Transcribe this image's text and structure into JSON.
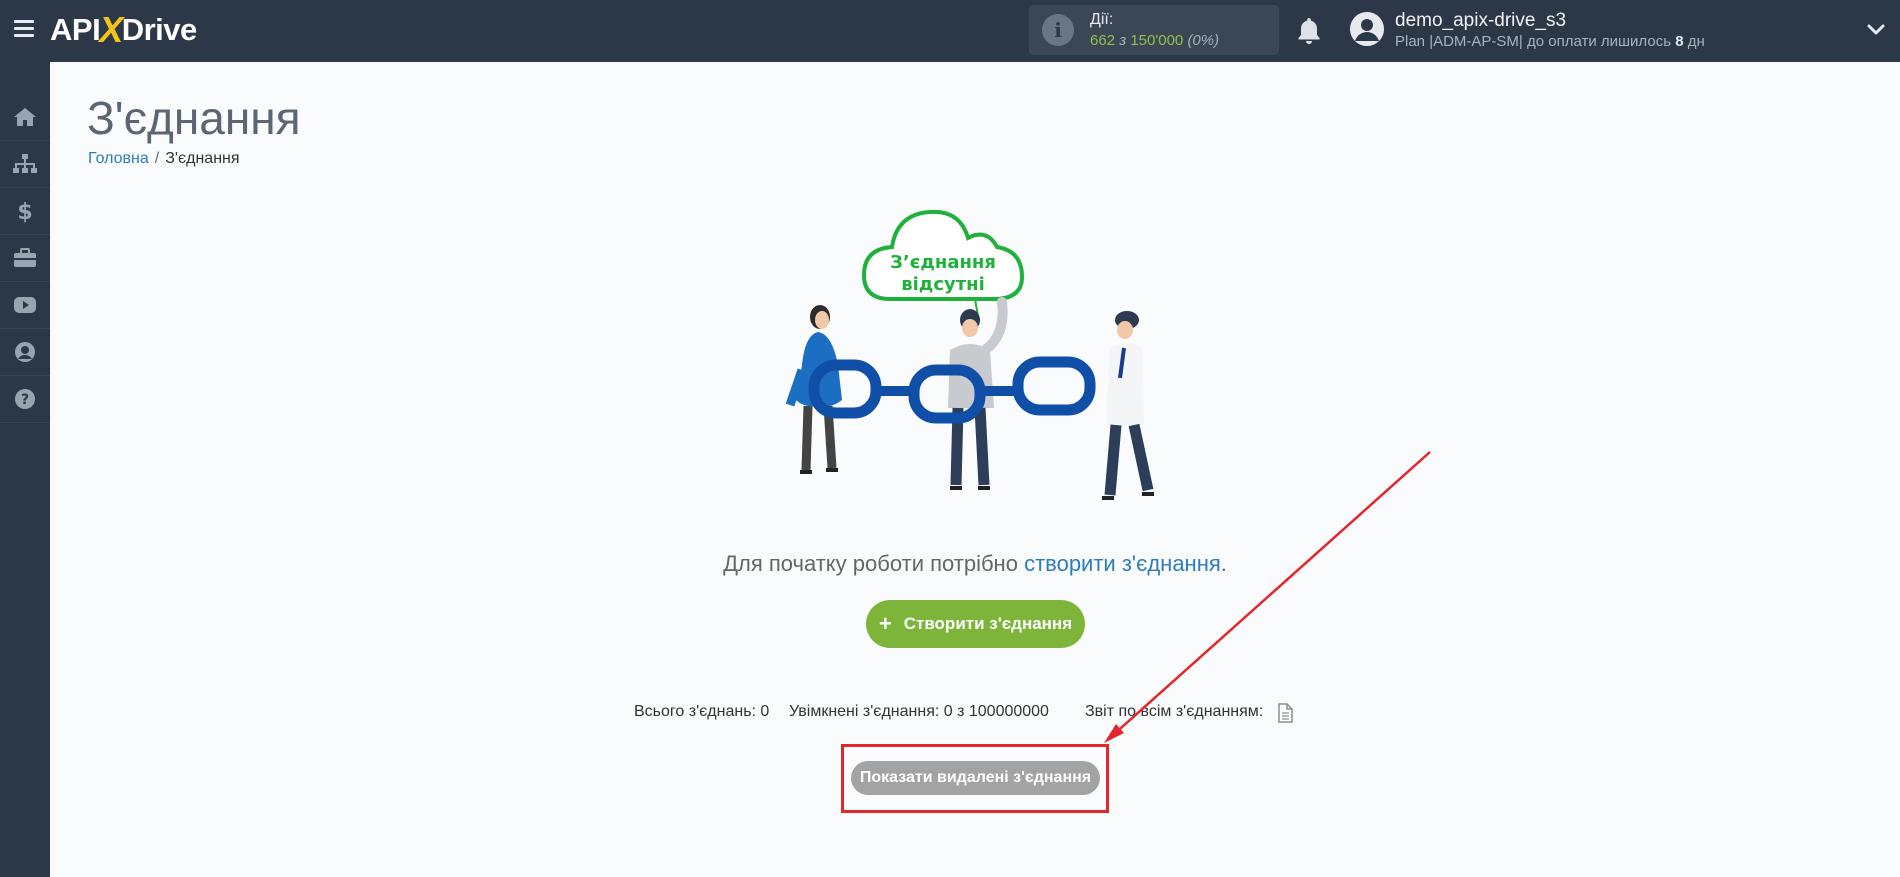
{
  "app": {
    "logo_part1": "API",
    "logo_x": "X",
    "logo_part2": "Drive"
  },
  "header": {
    "actions_label": "Дії:",
    "actions_used": "662",
    "actions_separator": " з ",
    "actions_total": "150'000",
    "actions_percent": "(0%)",
    "user_name": "demo_apix-drive_s3",
    "plan_text": "Plan |ADM-AP-SM| до оплати лишилось ",
    "days_left": "8",
    "days_unit": " дн"
  },
  "sidebar": {
    "items": [
      {
        "icon": "home-icon"
      },
      {
        "icon": "sitemap-icon"
      },
      {
        "icon": "dollar-icon"
      },
      {
        "icon": "briefcase-icon"
      },
      {
        "icon": "youtube-icon"
      },
      {
        "icon": "user-circle-icon"
      },
      {
        "icon": "question-icon"
      }
    ]
  },
  "page": {
    "title": "З'єднання",
    "breadcrumb_home": "Головна",
    "breadcrumb_sep": "/",
    "breadcrumb_current": "З'єднання"
  },
  "illustration": {
    "cloud_line1": "З’єднання",
    "cloud_line2": "відсутні"
  },
  "main": {
    "lead_text": "Для початку роботи потрібно ",
    "lead_link": "створити з'єднання",
    "lead_end": ".",
    "create_button": "Створити з'єднання",
    "create_button_icon": "+",
    "stat_total": "Всього з'єднань: 0",
    "stat_enabled": "Увімкнені з'єднання: 0 з 100000000",
    "stat_report": "Звіт по всім з'єднанням:",
    "show_deleted_button": "Показати видалені з'єднання"
  },
  "colors": {
    "topbar": "#2c3848",
    "accent_green": "#7db43a",
    "link_blue": "#2e7dbb",
    "highlight_red": "#e3262b"
  }
}
